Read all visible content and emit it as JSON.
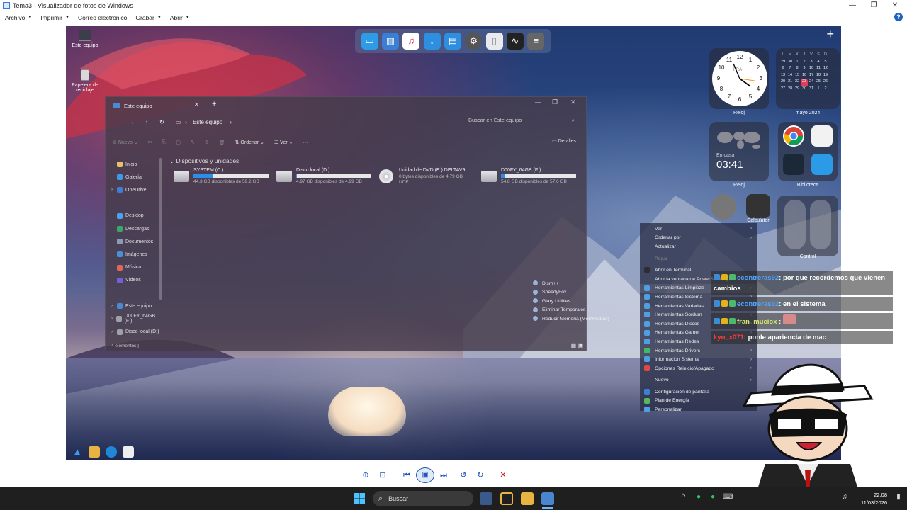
{
  "window": {
    "title": "Tema3 - Visualizador de fotos de Windows",
    "minimize": "—",
    "maximize": "❐",
    "close": "✕"
  },
  "menubar": {
    "items": [
      {
        "label": "Archivo",
        "dropdown": true
      },
      {
        "label": "Imprimir",
        "dropdown": true
      },
      {
        "label": "Correo electrónico",
        "dropdown": false
      },
      {
        "label": "Grabar",
        "dropdown": true
      },
      {
        "label": "Abrir",
        "dropdown": true
      }
    ],
    "help_label": "?"
  },
  "desktop": {
    "icons": [
      {
        "label": "Este equipo"
      },
      {
        "label": "Papelera de reciclaje"
      }
    ]
  },
  "explorer": {
    "tab_title": "Este equipo",
    "tab_close": "✕",
    "tab_new": "+",
    "nav": {
      "back": "←",
      "forward": "→",
      "up": "↑",
      "refresh": "↻",
      "breadcrumb_separator": "›",
      "breadcrumb": "Este equipo"
    },
    "search_placeholder": "Buscar en Este equipo",
    "toolbar": {
      "nuevo": "Nuevo",
      "ordenar": "Ordenar",
      "ver": "Ver",
      "more": "···",
      "details": "Detalles"
    },
    "sidebar": [
      {
        "label": "Inicio",
        "color": "#e8c06a",
        "arrow": ""
      },
      {
        "label": "Galería",
        "color": "#3d9be9",
        "arrow": ""
      },
      {
        "label": "OneDrive",
        "color": "#3d7fd6",
        "arrow": "›"
      },
      {
        "label": "",
        "color": "transparent",
        "arrow": ""
      },
      {
        "label": "Desktop",
        "color": "#4aa3f0",
        "arrow": ""
      },
      {
        "label": "Descargas",
        "color": "#38a86a",
        "arrow": ""
      },
      {
        "label": "Documentos",
        "color": "#8a9bb3",
        "arrow": ""
      },
      {
        "label": "Imágenes",
        "color": "#4a90d9",
        "arrow": ""
      },
      {
        "label": "Música",
        "color": "#e0655a",
        "arrow": ""
      },
      {
        "label": "Vídeos",
        "color": "#7b5cd6",
        "arrow": ""
      },
      {
        "label": "",
        "color": "transparent",
        "arrow": ""
      },
      {
        "label": "Este equipo",
        "color": "#4a88d8",
        "arrow": "›"
      },
      {
        "label": "D00FY_64GB (F:)",
        "color": "#9ea2aa",
        "arrow": "›"
      },
      {
        "label": "Disco local (D:)",
        "color": "#9ea2aa",
        "arrow": "›"
      }
    ],
    "section_title": "Dispositivos y unidades",
    "drives": [
      {
        "name": "SYSTEM (C:)",
        "free": "44,3 GB disponibles de 59,2 GB",
        "used_fraction": 0.25,
        "type": "disk"
      },
      {
        "name": "Disco local (D:)",
        "free": "4,97 GB disponibles de 4,99 GB",
        "used_fraction": 0.01,
        "type": "disk"
      },
      {
        "name": "Unidad de DVD (E:) DELTAV9",
        "free": "0 bytes disponibles de 4,79 GB",
        "extra": "UDF",
        "type": "dvd"
      },
      {
        "name": "D00FY_64GB (F:)",
        "free": "54,8 GB disponibles de 57,6 GB",
        "used_fraction": 0.05,
        "type": "disk"
      }
    ],
    "status": "4 elementos  |"
  },
  "context_menu": {
    "items": [
      {
        "label": "Ver",
        "submenu": true,
        "icon_color": ""
      },
      {
        "label": "Ordenar por",
        "submenu": true,
        "icon_color": ""
      },
      {
        "label": "Actualizar",
        "submenu": false,
        "icon_color": ""
      },
      {
        "label": "Pegar",
        "submenu": false,
        "icon_color": "",
        "disabled": true
      },
      {
        "label": "Abrir en Terminal",
        "submenu": false,
        "icon_color": "#2d2d2d"
      },
      {
        "label": "Abrir la ventana de PowerShell aquí",
        "submenu": false,
        "icon_color": ""
      },
      {
        "label": "Herramientas Limpieza",
        "submenu": true,
        "icon_color": "#4ea0e0",
        "highlight": true
      },
      {
        "label": "Herramientas Sistema",
        "submenu": true,
        "icon_color": "#4ea0e0"
      },
      {
        "label": "Herramientas Variadas",
        "submenu": true,
        "icon_color": "#4ea0e0"
      },
      {
        "label": "Herramientas Sordum",
        "submenu": true,
        "icon_color": "#4ea0e0"
      },
      {
        "label": "Herramientas Discos",
        "submenu": true,
        "icon_color": "#4ea0e0"
      },
      {
        "label": "Herramientas Gamer",
        "submenu": true,
        "icon_color": "#4ea0e0"
      },
      {
        "label": "Herramientas Redes",
        "submenu": true,
        "icon_color": "#4ea0e0"
      },
      {
        "label": "Herramientas Drivers",
        "submenu": true,
        "icon_color": "#3dbb6a"
      },
      {
        "label": "Informacion Sistema",
        "submenu": true,
        "icon_color": "#4ea0e0"
      },
      {
        "label": "Opciones Reinicio/Apagado",
        "submenu": true,
        "icon_color": "#e04848"
      },
      {
        "label": "Nuevo",
        "submenu": true,
        "icon_color": ""
      },
      {
        "label": "Configuración de pantalla",
        "submenu": false,
        "icon_color": "#3d7fd6"
      },
      {
        "label": "Plan de Energía",
        "submenu": false,
        "icon_color": "#58b85a"
      },
      {
        "label": "Personalizar",
        "submenu": false,
        "icon_color": "#4ea0e0"
      }
    ]
  },
  "cleanup_submenu": {
    "items": [
      "Dism++",
      "SpeedyFox",
      "Glary Utilities",
      "Eliminar Temporales",
      "Reducir Memoria (MemReduct)"
    ]
  },
  "widgets": {
    "clock_label": "Reloj",
    "clock_city": "FRA",
    "clock_numbers": [
      "12",
      "1",
      "2",
      "3",
      "4",
      "5",
      "6",
      "7",
      "8",
      "9",
      "10",
      "11"
    ],
    "calendar_label": "mayo 2024",
    "calendar_days_header": [
      "L",
      "M",
      "X",
      "J",
      "V",
      "S",
      "D"
    ],
    "calendar_rows": [
      [
        "29",
        "30",
        "1",
        "2",
        "3",
        "4",
        "5"
      ],
      [
        "6",
        "7",
        "8",
        "9",
        "10",
        "11",
        "12"
      ],
      [
        "13",
        "14",
        "15",
        "16",
        "17",
        "18",
        "19"
      ],
      [
        "20",
        "21",
        "22",
        "23",
        "24",
        "25",
        "26"
      ],
      [
        "27",
        "28",
        "29",
        "30",
        "31",
        "1",
        "2"
      ]
    ],
    "calendar_today": "23",
    "worldclock_label": "Reloj",
    "worldclock_place": "En casa",
    "worldclock_time": "03:41",
    "library_label": "Biblioteca",
    "calculator_label": "Calculator",
    "control_label": "Control"
  },
  "chat": {
    "messages": [
      {
        "user": "econtreras92",
        "text": ": por que recordemos que vienen cambios",
        "user_color": "u1"
      },
      {
        "user": "econtreras92",
        "text": ": en el sistema",
        "user_color": "u1"
      },
      {
        "user": "fran_muciox",
        "text": " :",
        "user_color": "u2"
      },
      {
        "user": "kyo_x071",
        "text": ": ponle apariencia de mac",
        "user_color": "u3"
      }
    ]
  },
  "viewer_controls": {
    "zoom": "⊕",
    "fit": "⊡",
    "previous": "⏮",
    "slideshow": "▣",
    "next": "⏭",
    "rotate_left": "↺",
    "rotate_right": "↻",
    "delete": "✕"
  },
  "taskbar": {
    "search_label": "Buscar",
    "time": "22:08",
    "date": "11/03/2026"
  }
}
